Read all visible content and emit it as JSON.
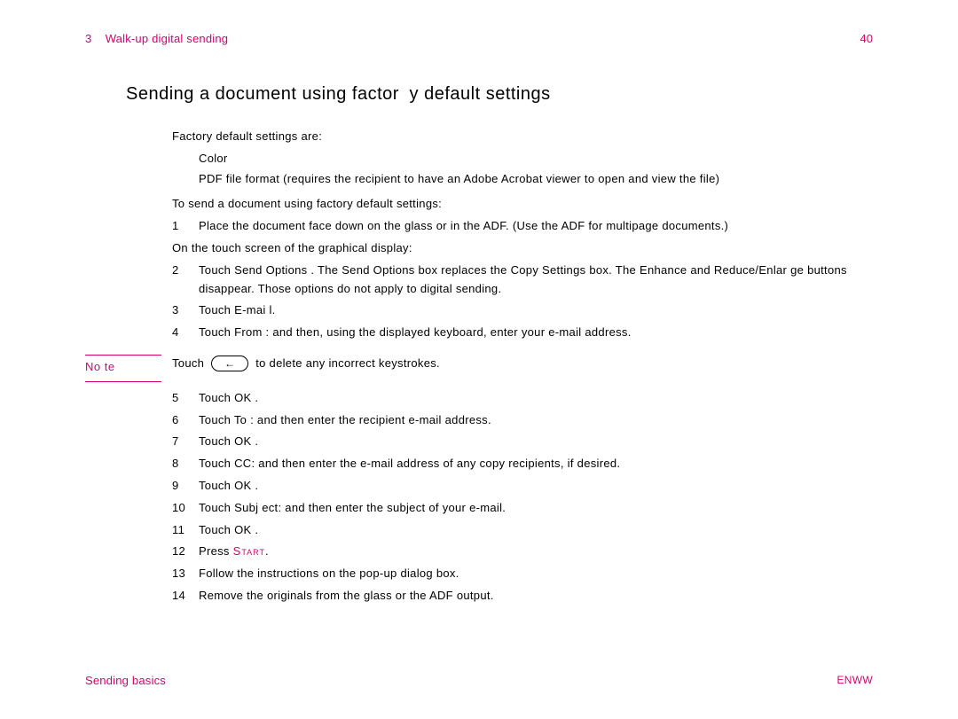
{
  "header": {
    "chapter_num": "3",
    "chapter_title": "Walk-up digital sending",
    "page_num": "40"
  },
  "title": "Sending a document using factor y default settings",
  "intro": "Factory default settings are:",
  "bullets": [
    "Color",
    "PDF file format (requires the recipient to have an Adobe Acrobat viewer to open and view the file)"
  ],
  "sub1": "To send a document using factory default settings:",
  "step1_num": "1",
  "step1_txt": "Place the document face down on the glass or in the ADF. (Use the ADF for multipage documents.)",
  "sub2": "On the touch screen of the graphical display:",
  "step2_num": "2",
  "step2_txt": "Touch Send Options . The Send Options box replaces the Copy Settings box. The Enhance  and Reduce/Enlar ge buttons disappear. Those options do not apply to digital sending.",
  "step3_num": "3",
  "step3_txt": "Touch E-mai l.",
  "step4_num": "4",
  "step4_txt": "Touch From :  and then, using the displayed keyboard, enter your e-mail address.",
  "note_label": "No te",
  "note_pre": "Touch",
  "note_post": "to delete any incorrect keystrokes.",
  "steps_rest": [
    {
      "n": "5",
      "t": "Touch OK ."
    },
    {
      "n": "6",
      "t": "Touch To :  and then enter the recipient e-mail address."
    },
    {
      "n": "7",
      "t": "Touch OK ."
    },
    {
      "n": "8",
      "t": "Touch CC:  and then enter the e-mail address of any copy recipients, if desired."
    },
    {
      "n": "9",
      "t": "Touch OK ."
    },
    {
      "n": "10",
      "t": "Touch Subj ect:  and then enter the subject of your e-mail."
    },
    {
      "n": "11",
      "t": "Touch OK ."
    }
  ],
  "step12_num": "12",
  "step12_pre": "Press ",
  "step12_start": "Start",
  "step12_post": ".",
  "steps_after": [
    {
      "n": "13",
      "t": "Follow the instructions on the pop-up dialog box."
    },
    {
      "n": "14",
      "t": "Remove the originals from the glass or the ADF output."
    }
  ],
  "footer": {
    "left": "Sending basics",
    "right": "ENWW"
  }
}
